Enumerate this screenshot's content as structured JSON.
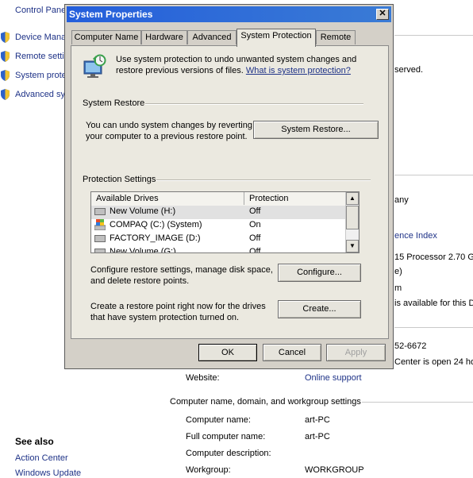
{
  "background": {
    "breadcrumb": "Control Pane",
    "tasks": [
      "Device Mana",
      "Remote setti",
      "System prote",
      "Advanced sy"
    ],
    "right_fragments": {
      "reserved": "served.",
      "company": "any",
      "index_link": "ence Index",
      "processor": "15 Processor   2.70 G",
      "paren": "e)",
      "m": "m",
      "available": "is available for this Di",
      "phone": "52-6672",
      "center": "Center is open 24 ho"
    },
    "website_label": "Website:",
    "website_value": "Online support",
    "section_title": "Computer name, domain, and workgroup settings",
    "fields": [
      {
        "label": "Computer name:",
        "value": "art-PC"
      },
      {
        "label": "Full computer name:",
        "value": "art-PC"
      },
      {
        "label": "Computer description:",
        "value": ""
      },
      {
        "label": "Workgroup:",
        "value": "WORKGROUP"
      }
    ],
    "see_also_heading": "See also",
    "see_also_items": [
      "Action Center",
      "Windows Update"
    ]
  },
  "dialog": {
    "title": "System Properties",
    "close_glyph": "✕",
    "tabs": [
      {
        "label": "Computer Name",
        "active": false
      },
      {
        "label": "Hardware",
        "active": false
      },
      {
        "label": "Advanced",
        "active": false
      },
      {
        "label": "System Protection",
        "active": true
      },
      {
        "label": "Remote",
        "active": false
      }
    ],
    "intro_text": "Use system protection to undo unwanted system changes and restore previous versions of files.",
    "intro_link": "What is system protection?",
    "system_restore": {
      "group_label": "System Restore",
      "text": "You can undo system changes by reverting your computer to a previous restore point.",
      "button": "System Restore..."
    },
    "protection_settings": {
      "group_label": "Protection Settings",
      "columns": [
        "Available Drives",
        "Protection"
      ],
      "drives": [
        {
          "name": "New Volume (H:)",
          "protection": "Off",
          "icon": "drive-icon",
          "selected": true
        },
        {
          "name": "COMPAQ (C:) (System)",
          "protection": "On",
          "icon": "windows-drive-icon",
          "selected": false
        },
        {
          "name": "FACTORY_IMAGE (D:)",
          "protection": "Off",
          "icon": "drive-icon",
          "selected": false
        },
        {
          "name": "New Volume (G:)",
          "protection": "Off",
          "icon": "drive-icon",
          "selected": false
        }
      ],
      "configure_text": "Configure restore settings, manage disk space, and delete restore points.",
      "configure_button": "Configure...",
      "create_text": "Create a restore point right now for the drives that have system protection turned on.",
      "create_button": "Create..."
    },
    "buttons": {
      "ok": "OK",
      "cancel": "Cancel",
      "apply": "Apply"
    }
  }
}
